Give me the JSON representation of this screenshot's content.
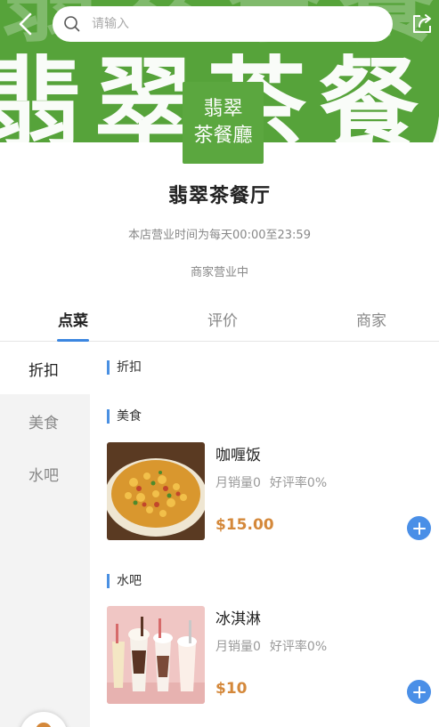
{
  "header": {
    "search_placeholder": "请输入",
    "banner_text": "翡翠茶餐廳",
    "logo_line1": "翡翠",
    "logo_line2": "茶餐廳",
    "colors": {
      "banner": "#56a33a",
      "accent": "#4a8fe7",
      "price": "#d4883a"
    }
  },
  "store": {
    "name": "翡翠茶餐厅",
    "hours": "本店营业时间为每天00:00至23:59",
    "status": "商家营业中"
  },
  "tabs": [
    {
      "label": "点菜",
      "active": true
    },
    {
      "label": "评价",
      "active": false
    },
    {
      "label": "商家",
      "active": false
    }
  ],
  "sidebar": {
    "items": [
      {
        "label": "折扣",
        "active": true
      },
      {
        "label": "美食",
        "active": false
      },
      {
        "label": "水吧",
        "active": false
      }
    ]
  },
  "sections": [
    {
      "title": "折扣",
      "items": []
    },
    {
      "title": "美食",
      "items": [
        {
          "name": "咖喱饭",
          "monthly_sales": "月销量0",
          "rating": "好评率0%",
          "price": "$15.00",
          "image_icon": "curry-rice-image"
        }
      ]
    },
    {
      "title": "水吧",
      "items": [
        {
          "name": "冰淇淋",
          "monthly_sales": "月销量0",
          "rating": "好评率0%",
          "price": "$10",
          "image_icon": "milkshake-image"
        }
      ]
    }
  ]
}
